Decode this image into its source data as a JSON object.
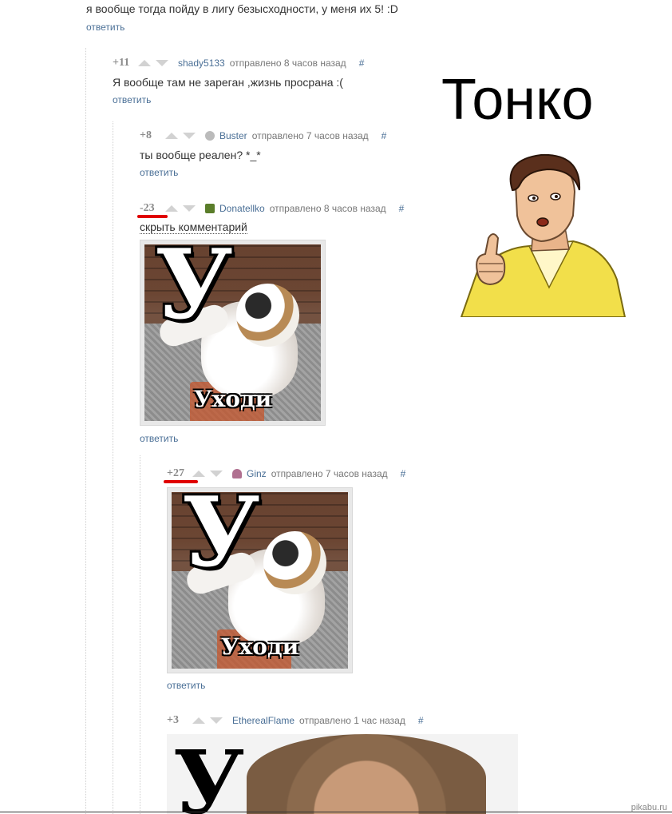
{
  "comments": {
    "top": {
      "text": "я вообще тогда пойду в лигу безысходности, у меня их 5! :D",
      "reply": "ответить"
    },
    "c1": {
      "score": "+11",
      "user": "shady5133",
      "sent": "отправлено 8 часов назад",
      "hash": "#",
      "text": "Я вообще там не зареган ,жизнь просрана :(",
      "reply": "ответить"
    },
    "c2": {
      "score": "+8",
      "user": "Buster",
      "sent": "отправлено 7 часов назад",
      "hash": "#",
      "text": "ты вообще реален? *_*",
      "reply": "ответить"
    },
    "c3": {
      "score": "-23",
      "user": "Donatellko",
      "sent": "отправлено 8 часов назад",
      "hash": "#",
      "hide": "скрыть комментарий",
      "reply": "ответить"
    },
    "c4": {
      "score": "+27",
      "user": "Ginz",
      "sent": "отправлено 7 часов назад",
      "hash": "#",
      "reply": "ответить"
    },
    "c5": {
      "score": "+3",
      "user": "EtherealFlame",
      "sent": "отправлено 1 час назад",
      "hash": "#"
    }
  },
  "meme": {
    "letter": "У",
    "caption": "Уходи"
  },
  "overlay": {
    "tonko": "Тонко",
    "watermark": "pikabu.ru"
  },
  "colors": {
    "link": "#4a6f96",
    "highlight": "#e00000"
  },
  "icons": {
    "upvote": "triangle-up-icon",
    "downvote": "triangle-down-icon",
    "avatar": "user-avatar-icon"
  }
}
